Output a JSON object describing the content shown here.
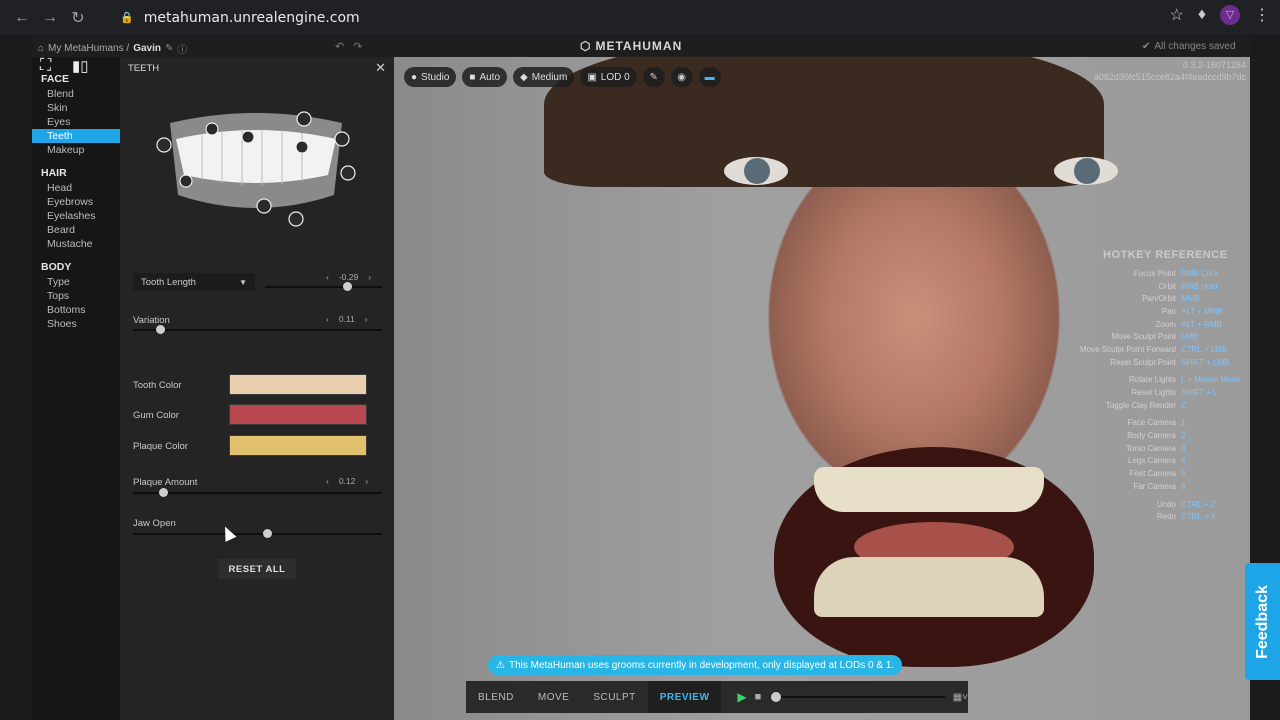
{
  "browser": {
    "url": "metahuman.unrealengine.com"
  },
  "topbar": {
    "breadcrumb_root": "My MetaHumans /",
    "breadcrumb_current": "Gavin",
    "logo": "METAHUMAN",
    "saved_status": "All changes saved"
  },
  "sidebar": {
    "face_header": "FACE",
    "face_items": [
      "Blend",
      "Skin",
      "Eyes",
      "Teeth",
      "Makeup"
    ],
    "hair_header": "HAIR",
    "hair_items": [
      "Head",
      "Eyebrows",
      "Eyelashes",
      "Beard",
      "Mustache"
    ],
    "body_header": "BODY",
    "body_items": [
      "Type",
      "Tops",
      "Bottoms",
      "Shoes"
    ],
    "active_item": "Teeth"
  },
  "panel": {
    "title": "TEETH",
    "dropdown_label": "Tooth Length",
    "tooth_length_value": "-0.29",
    "tooth_length_level": 0.7,
    "variation_label": "Variation",
    "variation_value": "0.11",
    "variation_level": 0.11,
    "tooth_color_label": "Tooth Color",
    "tooth_color": "#e9cfae",
    "gum_color_label": "Gum Color",
    "gum_color": "#b84750",
    "plaque_color_label": "Plaque Color",
    "plaque_color": "#e2c16e",
    "plaque_amount_label": "Plaque Amount",
    "plaque_amount_value": "0.12",
    "plaque_amount_level": 0.12,
    "jaw_open_label": "Jaw Open",
    "jaw_open_level": 0.54,
    "reset_label": "RESET ALL"
  },
  "viewport": {
    "toolbar": [
      "Studio",
      "Auto",
      "Medium",
      "LOD 0"
    ],
    "version_line1": "0.3.2-16071284",
    "version_line2": "a082d30fc515cce82a4f4eadccd9b7dc",
    "hotkey_title": "HOTKEY REFERENCE",
    "hotkeys": [
      {
        "k": "Focus Point",
        "v": "RMB Click"
      },
      {
        "k": "Orbit",
        "v": "RMB Hold"
      },
      {
        "k": "Pan/Orbit",
        "v": "MMB"
      },
      {
        "k": "Pan",
        "v": "ALT + MMB"
      },
      {
        "k": "Zoom",
        "v": "ALT + RMB"
      },
      {
        "k": "Move Sculpt Point",
        "v": "LMB"
      },
      {
        "k": "Move Sculpt Point Forward",
        "v": "CTRL + LMB"
      },
      {
        "k": "Reset Sculpt Point",
        "v": "SHIFT + LMB"
      },
      {
        "gap": true
      },
      {
        "k": "Rotate Lights",
        "v": "L + Mouse Move"
      },
      {
        "k": "Reset Lights",
        "v": "SHIFT + L"
      },
      {
        "k": "Toggle Clay Render",
        "v": "C"
      },
      {
        "gap": true
      },
      {
        "k": "Face Camera",
        "v": "1"
      },
      {
        "k": "Body Camera",
        "v": "2"
      },
      {
        "k": "Torso Camera",
        "v": "3"
      },
      {
        "k": "Legs Camera",
        "v": "4"
      },
      {
        "k": "Feet Camera",
        "v": "5"
      },
      {
        "k": "Far Camera",
        "v": "6"
      },
      {
        "gap": true
      },
      {
        "k": "Undo",
        "v": "CTRL + Z"
      },
      {
        "k": "Redo",
        "v": "CTRL + Y"
      }
    ],
    "notice": "This MetaHuman uses grooms currently in development, only displayed at LODs 0 & 1.",
    "modes": [
      "BLEND",
      "MOVE",
      "SCULPT",
      "PREVIEW"
    ],
    "active_mode": "PREVIEW"
  },
  "feedback_label": "Feedback"
}
